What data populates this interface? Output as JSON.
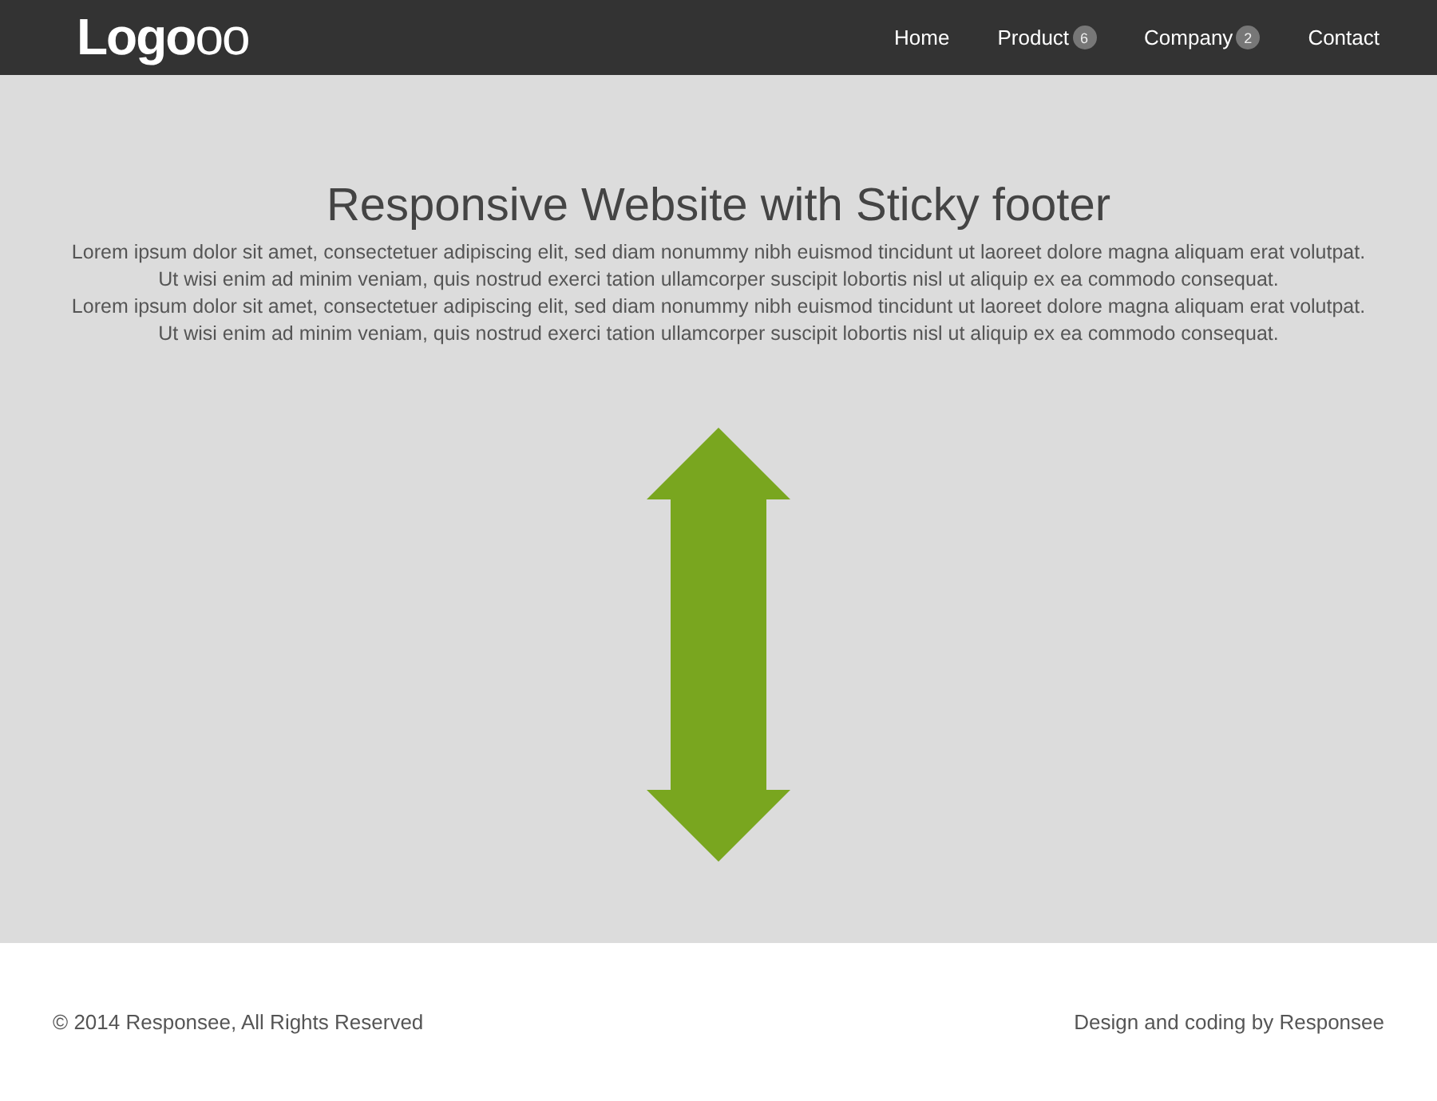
{
  "header": {
    "logo": "**Logo**oo",
    "nav": [
      {
        "label": "Home"
      },
      {
        "label": "Product",
        "badge": "6"
      },
      {
        "label": "Company",
        "badge": "2"
      },
      {
        "label": "Contact"
      }
    ]
  },
  "main": {
    "title": "Responsive Website with Sticky footer",
    "lines": [
      "Lorem ipsum dolor sit amet, consectetuer adipiscing elit, sed diam nonummy nibh euismod tincidunt ut laoreet dolore magna aliquam erat volutpat.",
      "Ut wisi enim ad minim veniam, quis nostrud exerci tation ullamcorper suscipit lobortis nisl ut aliquip ex ea commodo consequat.",
      "Lorem ipsum dolor sit amet, consectetuer adipiscing elit, sed diam nonummy nibh euismod tincidunt ut laoreet dolore magna aliquam erat volutpat.",
      "Ut wisi enim ad minim veniam, quis nostrud exerci tation ullamcorper suscipit lobortis nisl ut aliquip ex ea commodo consequat."
    ]
  },
  "footer": {
    "copyright": "© 2014 Responsee, All Rights Reserved",
    "credit": "Design and coding by Responsee"
  }
}
